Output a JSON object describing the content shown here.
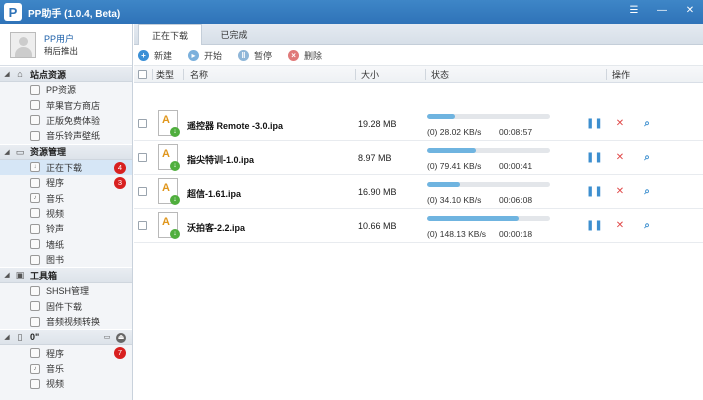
{
  "app": {
    "title": "PP助手 (1.0.4, Beta)",
    "logo_letter": "P"
  },
  "window_controls": [
    "menu-icon",
    "minimize-icon",
    "close-icon"
  ],
  "user": {
    "name": "PP用户",
    "subtitle": "稍后推出"
  },
  "sidebar": {
    "sections": [
      {
        "label": "站点资源",
        "icon": "home-icon",
        "items": [
          {
            "label": "PP资源"
          },
          {
            "label": "苹果官方商店"
          },
          {
            "label": "正版免费体验"
          },
          {
            "label": "音乐铃声壁纸"
          }
        ]
      },
      {
        "label": "资源管理",
        "icon": "monitor-icon",
        "items": [
          {
            "label": "正在下载",
            "badge": "4",
            "active": true
          },
          {
            "label": "程序",
            "badge": "3"
          },
          {
            "label": "音乐"
          },
          {
            "label": "视频"
          },
          {
            "label": "铃声"
          },
          {
            "label": "墙纸"
          },
          {
            "label": "图书"
          }
        ]
      },
      {
        "label": "工具箱",
        "icon": "toolbox-icon",
        "items": [
          {
            "label": "SHSH管理"
          },
          {
            "label": "固件下载"
          },
          {
            "label": "音频视频转换"
          }
        ]
      },
      {
        "label": "0\"",
        "icon": "phone-icon",
        "items": [
          {
            "label": "程序",
            "badge": "7"
          },
          {
            "label": "音乐"
          },
          {
            "label": "视频"
          }
        ]
      }
    ]
  },
  "tabs": [
    {
      "label": "正在下载",
      "active": true
    },
    {
      "label": "已完成",
      "active": false
    }
  ],
  "toolbar": {
    "new": "新建",
    "start": "开始",
    "pause": "暂停",
    "delete": "删除"
  },
  "table": {
    "headers": {
      "type": "类型",
      "name": "名称",
      "size": "大小",
      "status": "状态",
      "ops": "操作"
    },
    "rows": [
      {
        "name": "遥控器 Remote -3.0.ipa",
        "size": "19.28 MB",
        "progress": 0.23,
        "speed": "(0) 28.02 KB/s",
        "time": "00:08:57"
      },
      {
        "name": "指尖特训-1.0.ipa",
        "size": "8.97 MB",
        "progress": 0.4,
        "speed": "(0) 79.41 KB/s",
        "time": "00:00:41"
      },
      {
        "name": "超信-1.61.ipa",
        "size": "16.90 MB",
        "progress": 0.27,
        "speed": "(0) 34.10 KB/s",
        "time": "00:06:08"
      },
      {
        "name": "沃拍客-2.2.ipa",
        "size": "10.66 MB",
        "progress": 0.75,
        "speed": "(0) 148.13 KB/s",
        "time": "00:00:18"
      }
    ]
  },
  "colors": {
    "titlebar": "#2f73b8",
    "progress": "#6fb4e0",
    "badge": "#d82020"
  }
}
